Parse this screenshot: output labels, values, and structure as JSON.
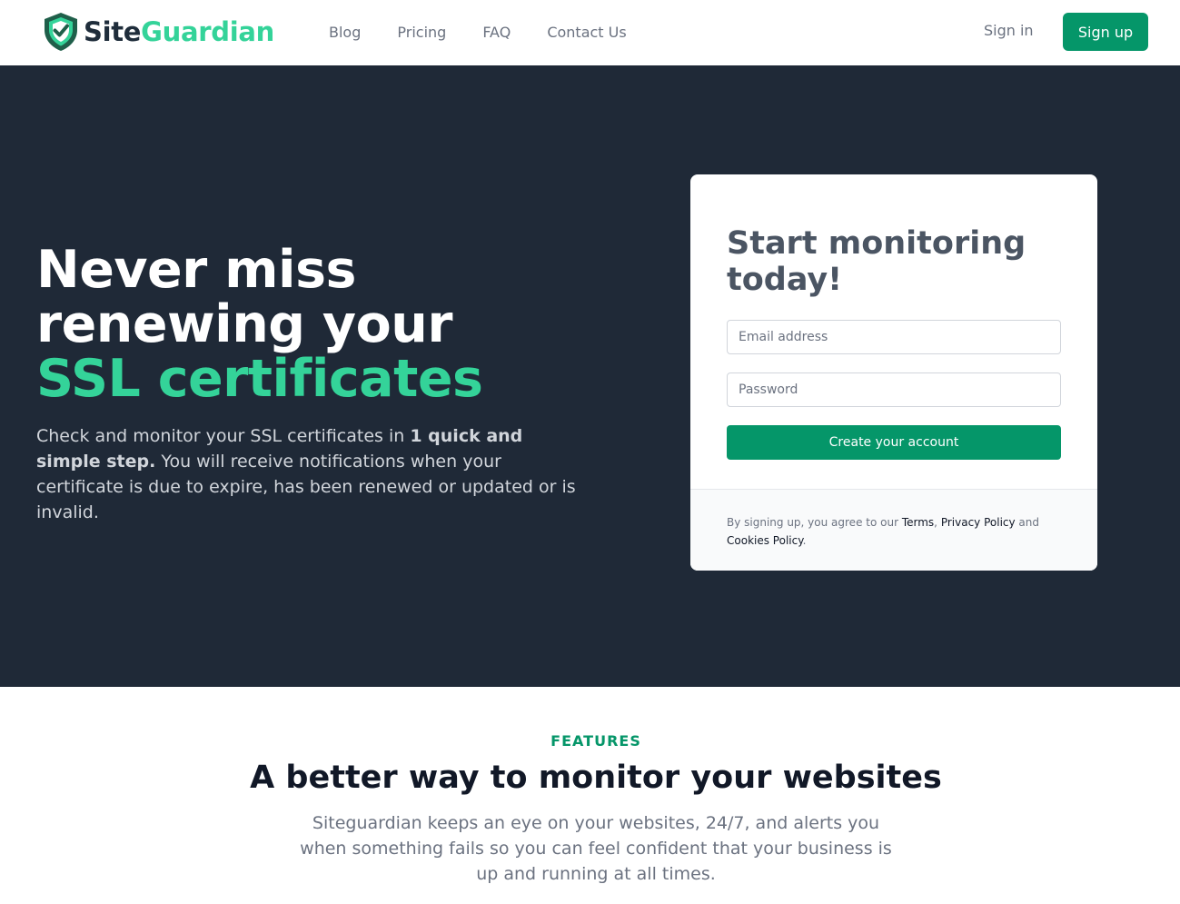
{
  "header": {
    "logo": {
      "part1": "Site",
      "part2": "Guardian"
    },
    "nav": [
      {
        "label": "Blog"
      },
      {
        "label": "Pricing"
      },
      {
        "label": "FAQ"
      },
      {
        "label": "Contact Us"
      }
    ],
    "signin_label": "Sign in",
    "signup_label": "Sign up"
  },
  "hero": {
    "title_line1": "Never miss",
    "title_line2": "renewing your",
    "title_accent": "SSL certificates",
    "desc_prefix": "Check and monitor your SSL certificates in ",
    "desc_strong": "1 quick and simple step.",
    "desc_suffix": " You will receive notifications when your certificate is due to expire, has been renewed or updated or is invalid."
  },
  "signup_card": {
    "title": "Start monitoring today!",
    "email_placeholder": "Email address",
    "password_placeholder": "Password",
    "submit_label": "Create your account",
    "legal": {
      "prefix": "By signing up, you agree to our ",
      "terms": "Terms",
      "comma": ",",
      "privacy": "Privacy Policy",
      "and": " and",
      "cookies": "Cookies Policy",
      "period": "."
    }
  },
  "features": {
    "eyebrow": "FEATURES",
    "title": "A better way to monitor your websites",
    "description": "Siteguardian keeps an eye on your websites, 24/7, and alerts you when something fails so you can feel confident that your business is up and running at all times."
  },
  "colors": {
    "brand": "#059669",
    "accent": "#34d399",
    "hero_bg": "#1f2937"
  },
  "icons": {
    "logo": "shield-check-icon"
  }
}
